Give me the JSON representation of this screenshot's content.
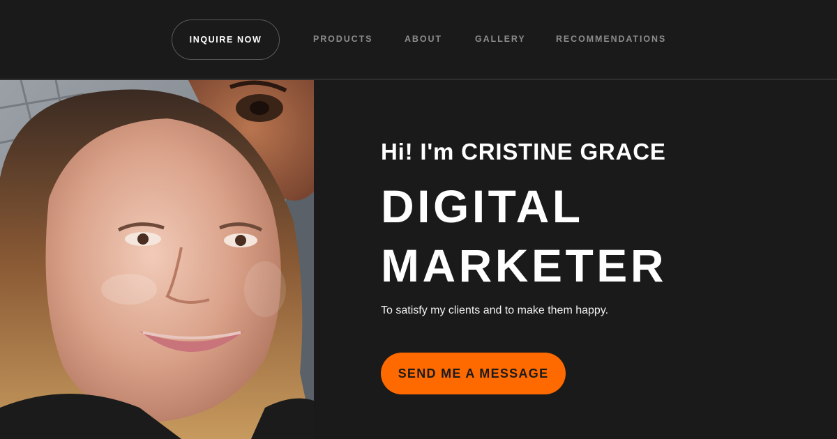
{
  "header": {
    "inquire_label": "INQUIRE NOW",
    "nav": {
      "products": "PRODUCTS",
      "about": "ABOUT",
      "gallery": "GALLERY",
      "recommendations": "RECOMMENDATIONS"
    }
  },
  "hero": {
    "greeting": "Hi! I'm CRISTINE GRACE",
    "title_line1": "DIGITAL",
    "title_line2": "MARKETER",
    "tagline": "To satisfy my clients and to make them happy.",
    "cta_label": "SEND ME A MESSAGE"
  },
  "colors": {
    "background": "#1a1a1a",
    "accent": "#ff6a00",
    "nav_text": "#8c8c8c"
  }
}
